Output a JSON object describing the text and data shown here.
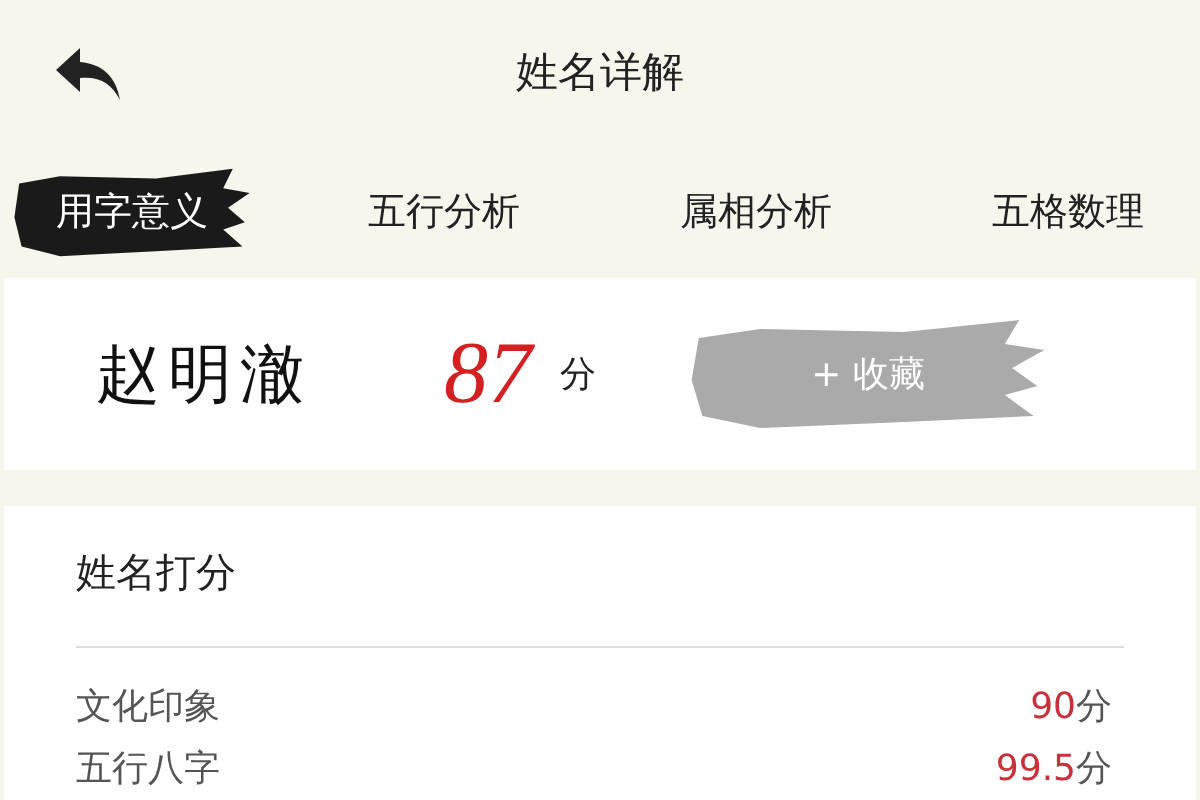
{
  "header": {
    "title": "姓名详解"
  },
  "tabs": [
    {
      "label": "用字意义",
      "selected": true
    },
    {
      "label": "五行分析",
      "selected": false
    },
    {
      "label": "属相分析",
      "selected": false
    },
    {
      "label": "五格数理",
      "selected": false
    }
  ],
  "summary": {
    "name": "赵明澈",
    "score": "87",
    "unit": "分",
    "favorite_button": "+ 收藏"
  },
  "rating": {
    "title": "姓名打分",
    "rows": [
      {
        "label": "文化印象",
        "value": "90",
        "unit": "分"
      },
      {
        "label": "五行八字",
        "value": "99.5",
        "unit": "分"
      }
    ]
  }
}
